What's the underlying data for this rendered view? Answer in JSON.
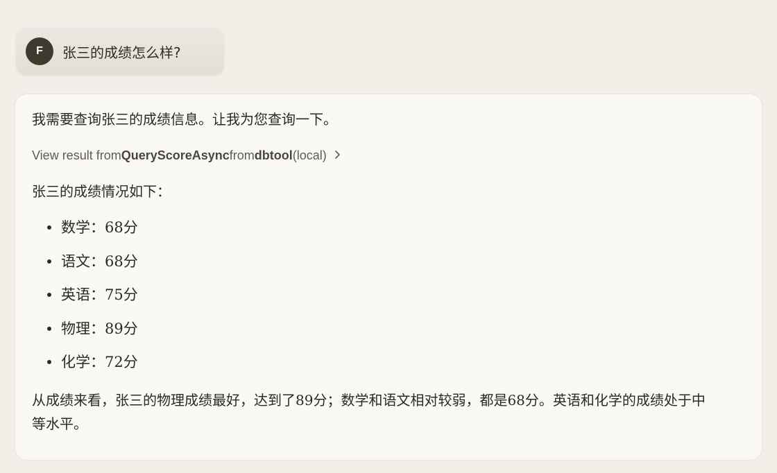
{
  "user_message": {
    "avatar_initial": "F",
    "text": "张三的成绩怎么样?"
  },
  "response": {
    "intro": "我需要查询张三的成绩信息。让我为您查询一下。",
    "tool_call": {
      "prefix": "View result from ",
      "tool_name": "QueryScoreAsync",
      "middle": " from ",
      "server": "dbtool",
      "suffix": " (local)",
      "chevron_icon": "chevron-right-icon"
    },
    "summary_heading": "张三的成绩情况如下：",
    "scores": [
      {
        "text": "数学：68分"
      },
      {
        "text": "语文：68分"
      },
      {
        "text": "英语：75分"
      },
      {
        "text": "物理：89分"
      },
      {
        "text": "化学：72分"
      }
    ],
    "conclusion": "从成绩来看，张三的物理成绩最好，达到了89分；数学和语文相对较弱，都是68分。英语和化学的成绩处于中等水平。"
  },
  "colors": {
    "background": "#f2efe9",
    "card": "#faf9f6",
    "avatar": "#3d3a2e",
    "user_bubble": "#e6e2da"
  }
}
